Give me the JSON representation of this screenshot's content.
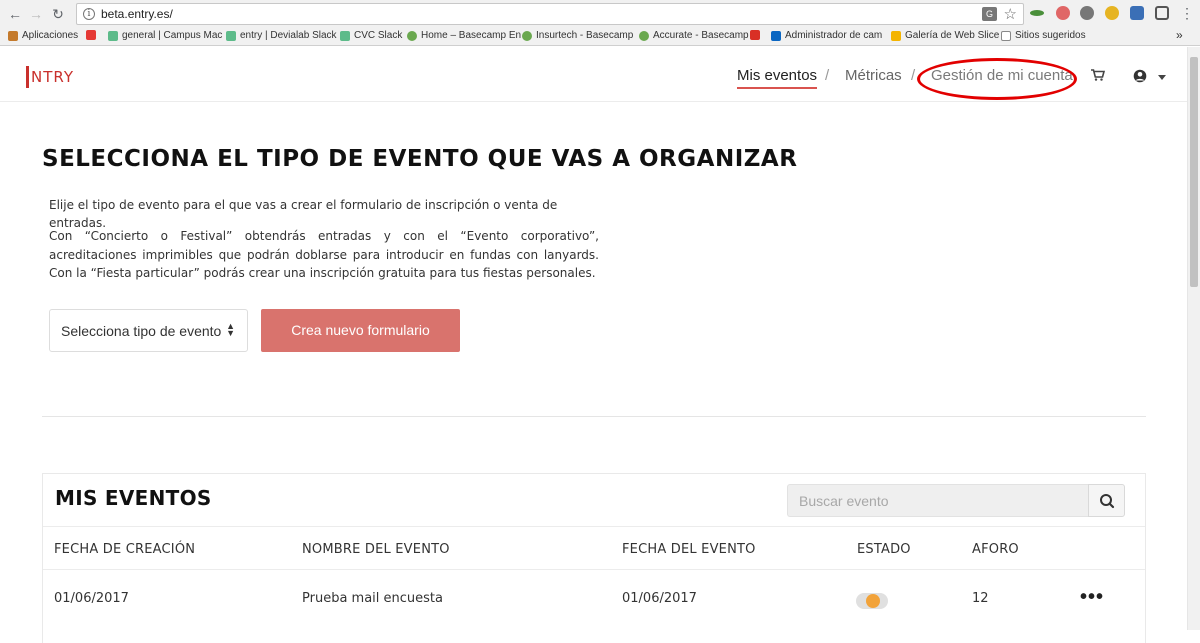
{
  "browser": {
    "url": "beta.entry.es/",
    "bookmarks": [
      "Aplicaciones",
      "general | Campus Mac",
      "entry | Devialab Slack",
      "CVC Slack",
      "Home – Basecamp En",
      "Insurtech - Basecamp",
      "Accurate - Basecamp",
      "Administrador de cam",
      "Galería de Web Slice",
      "Sitios sugeridos"
    ],
    "more_bookmarks": "»"
  },
  "header": {
    "logo_text": "NTRY",
    "nav": [
      "Mis eventos",
      "Métricas",
      "Gestión de mi cuenta"
    ],
    "separator": "/"
  },
  "main": {
    "title": "SELECCIONA EL TIPO DE EVENTO QUE VAS A ORGANIZAR",
    "intro": "Elije el tipo de evento para el que vas a crear el formulario de inscripción o venta de entradas.",
    "intro2": "Con “Concierto o Festival” obtendrás entradas y con el “Evento corporativo”, acreditaciones imprimibles que podrán doblarse para introducir en fundas con lanyards. Con la “Fiesta particular” podrás crear una inscripción gratuita para tus fiestas personales.",
    "select_label": "Selecciona tipo de evento",
    "create_button": "Crea nuevo formulario"
  },
  "events": {
    "title": "MIS EVENTOS",
    "search_placeholder": "Buscar evento",
    "columns": [
      "FECHA DE CREACIÓN",
      "NOMBRE DEL EVENTO",
      "FECHA DEL EVENTO",
      "ESTADO",
      "AFORO"
    ],
    "rows": [
      {
        "created": "01/06/2017",
        "name": "Prueba mail encuesta",
        "date": "01/06/2017",
        "status": "toggle",
        "capacity": "12",
        "menu": "•••"
      }
    ]
  },
  "colors": {
    "accent": "#d9534f",
    "button": "#d9736d",
    "annotation": "#e20000",
    "toggle_knob": "#f2a33a"
  },
  "icons": [
    "back-icon",
    "forward-icon",
    "reload-icon",
    "info-icon",
    "translate-icon",
    "star-icon",
    "cart-icon",
    "user-icon",
    "caret-down-icon",
    "search-icon",
    "more-dots-icon"
  ]
}
